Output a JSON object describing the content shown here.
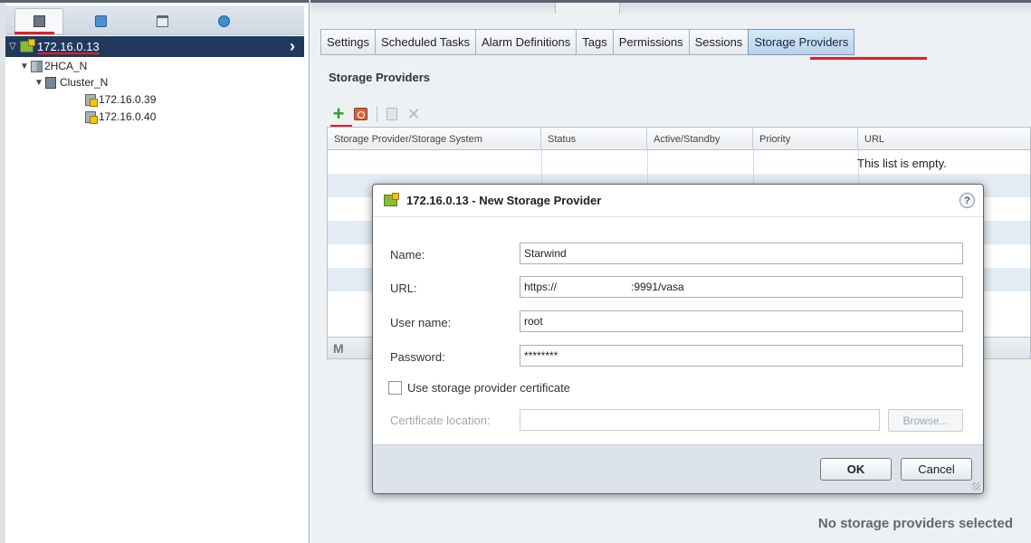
{
  "nav": {
    "tabs": [
      {
        "icon": "hosts-clusters-icon",
        "active": true
      },
      {
        "icon": "vms-templates-icon",
        "active": false
      },
      {
        "icon": "storage-icon",
        "active": false
      },
      {
        "icon": "networking-icon",
        "active": false
      }
    ],
    "tree": {
      "root": "172.16.0.13",
      "datacenter": "2HCA_N",
      "cluster": "Cluster_N",
      "hosts": [
        "172.16.0.39",
        "172.16.0.40"
      ]
    }
  },
  "tabs": [
    "Settings",
    "Scheduled Tasks",
    "Alarm Definitions",
    "Tags",
    "Permissions",
    "Sessions",
    "Storage Providers"
  ],
  "active_tab": "Storage Providers",
  "section": {
    "title": "Storage Providers"
  },
  "grid": {
    "columns": [
      "Storage Provider/Storage System",
      "Status",
      "Active/Standby",
      "Priority",
      "URL"
    ],
    "empty_message": "This list is empty."
  },
  "detail": {
    "no_selection": "No storage providers selected"
  },
  "dialog": {
    "title": "172.16.0.13 - New Storage Provider",
    "help": "?",
    "fields": {
      "name_label": "Name:",
      "name_value": "Starwind",
      "url_label": "URL:",
      "url_proto": "https://",
      "url_rest": ":9991/vasa",
      "user_label": "User name:",
      "user_value": "root",
      "password_label": "Password:",
      "password_value": "********"
    },
    "certificate": {
      "checkbox_label": "Use storage provider certificate",
      "location_label": "Certificate location:",
      "browse_label": "Browse..."
    },
    "buttons": {
      "ok": "OK",
      "cancel": "Cancel"
    }
  },
  "colors": {
    "selection": "#1f3a5c",
    "highlight_red": "#e0202a",
    "active_tab": "#b9d3ec",
    "add_green": "#2f9e2f"
  }
}
